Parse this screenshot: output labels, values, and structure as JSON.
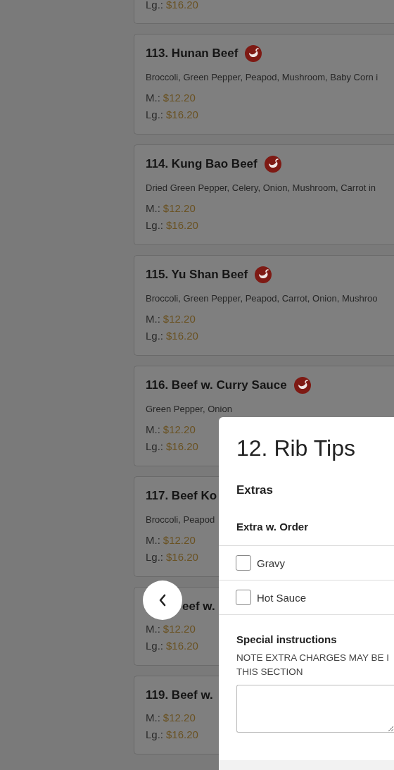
{
  "menu_items": [
    {
      "prices": [
        {
          "size": "Lg.:",
          "price": "$16.20"
        }
      ],
      "cut_top": true
    },
    {
      "name": "113. Hunan Beef",
      "description": "Broccoli, Green Pepper, Peapod, Mushroom, Baby Corn i",
      "prices": [
        {
          "size": "M.:",
          "price": "$12.20"
        },
        {
          "size": "Lg.:",
          "price": "$16.20"
        }
      ],
      "spicy": true
    },
    {
      "name": "114. Kung Bao Beef",
      "description": "Dried Green Pepper, Celery, Onion, Mushroom, Carrot in",
      "prices": [
        {
          "size": "M.:",
          "price": "$12.20"
        },
        {
          "size": "Lg.:",
          "price": "$16.20"
        }
      ],
      "spicy": true
    },
    {
      "name": "115. Yu Shan Beef",
      "description": "Broccoli, Green Pepper, Peapod, Carrot, Onion, Mushroo",
      "prices": [
        {
          "size": "M.:",
          "price": "$12.20"
        },
        {
          "size": "Lg.:",
          "price": "$16.20"
        }
      ],
      "spicy": true
    },
    {
      "name": "116. Beef w. Curry Sauce",
      "description": "Green Pepper, Onion",
      "prices": [
        {
          "size": "M.:",
          "price": "$12.20"
        },
        {
          "size": "Lg.:",
          "price": "$16.20"
        }
      ],
      "spicy": true
    },
    {
      "name": "117. Beef Ko",
      "description": "Broccoli, Peapod",
      "prices": [
        {
          "size": "M.:",
          "price": "$12.20"
        },
        {
          "size": "Lg.:",
          "price": "$16.20"
        }
      ],
      "spicy": false
    },
    {
      "name": "eef w.",
      "prices": [
        {
          "size": "M.:",
          "price": "$12.20"
        },
        {
          "size": "Lg.:",
          "price": "$16.20"
        }
      ],
      "spicy": false,
      "behind_back_button": true
    },
    {
      "name": "119. Beef w.",
      "prices": [
        {
          "size": "M.:",
          "price": "$12.20"
        },
        {
          "size": "Lg.:",
          "price": "$16.20"
        }
      ],
      "spicy": false
    }
  ],
  "dialog": {
    "title": "12. Rib Tips",
    "section": "Extras",
    "group": "Extra w. Order",
    "options": [
      {
        "label": "Gravy",
        "checked": false
      },
      {
        "label": "Hot Sauce",
        "checked": false
      }
    ],
    "instructions": {
      "label": "Special instructions",
      "note_lines": [
        "NOTE EXTRA CHARGES MAY BE I",
        "THIS SECTION"
      ]
    }
  }
}
